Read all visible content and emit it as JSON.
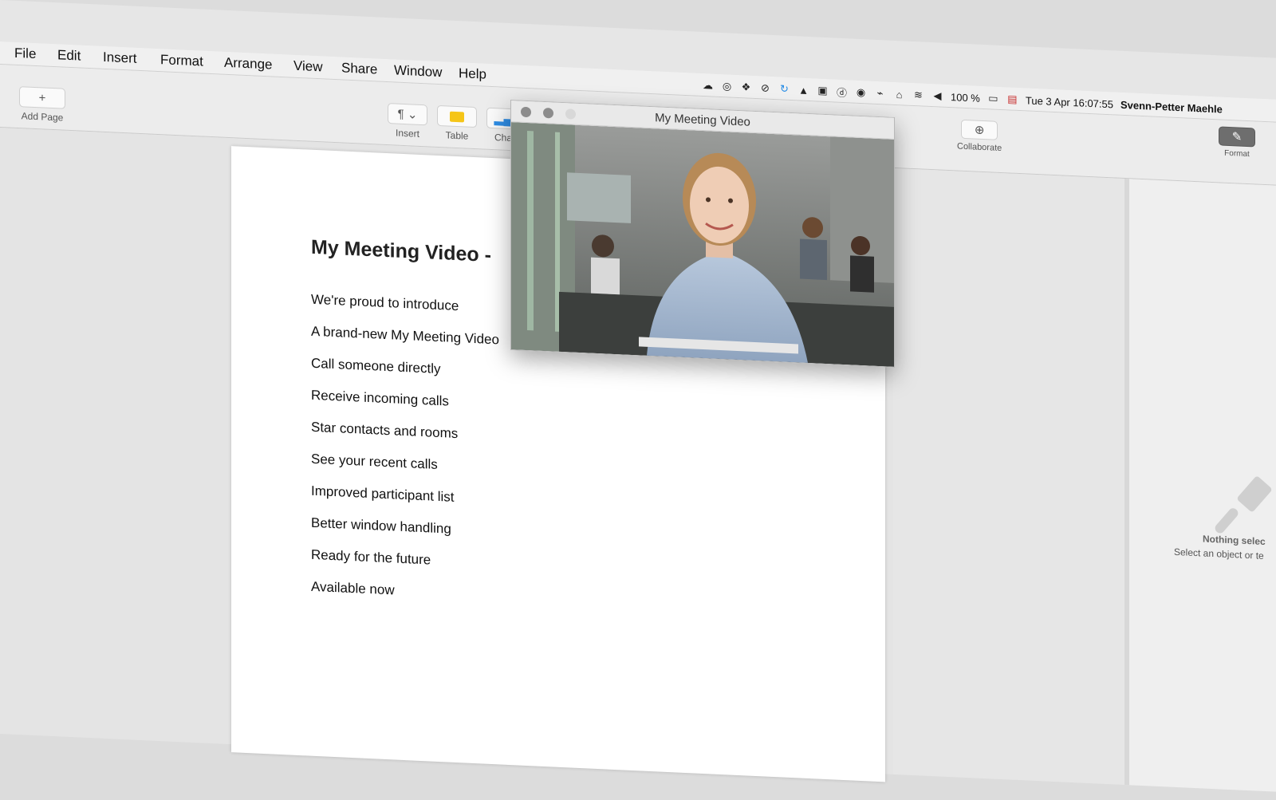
{
  "menubar": {
    "items": [
      "File",
      "Edit",
      "Insert",
      "Format",
      "Arrange",
      "View",
      "Share",
      "Window",
      "Help"
    ],
    "status": {
      "battery": "100 %",
      "datetime": "Tue 3 Apr  16:07:55",
      "user": "Svenn-Petter Maehle"
    }
  },
  "toolbar": {
    "add_page_label": "Add Page",
    "insert_label": "Insert",
    "table_label": "Table",
    "chart_label": "Cha",
    "collaborate_label": "Collaborate",
    "format_label": "Format"
  },
  "document": {
    "title": "My Meeting Video -",
    "lines": [
      "We're proud to introduce",
      "A brand-new My Meeting Video",
      "Call someone directly",
      "Receive incoming calls",
      "Star contacts and rooms",
      "See your recent calls",
      "Improved participant list",
      "Better window handling",
      "Ready for the future",
      "Available now"
    ]
  },
  "video_window": {
    "title": "My Meeting Video"
  },
  "inspector": {
    "title": "Nothing selec",
    "subtitle": "Select an object or te"
  },
  "colors": {
    "menubar": "#f0f0f0",
    "toolbar": "#ececec",
    "page": "#ffffff",
    "table_icon": "#f5c518",
    "chart_icon": "#2e8de6",
    "traffic_light": "#8c8c8c"
  }
}
